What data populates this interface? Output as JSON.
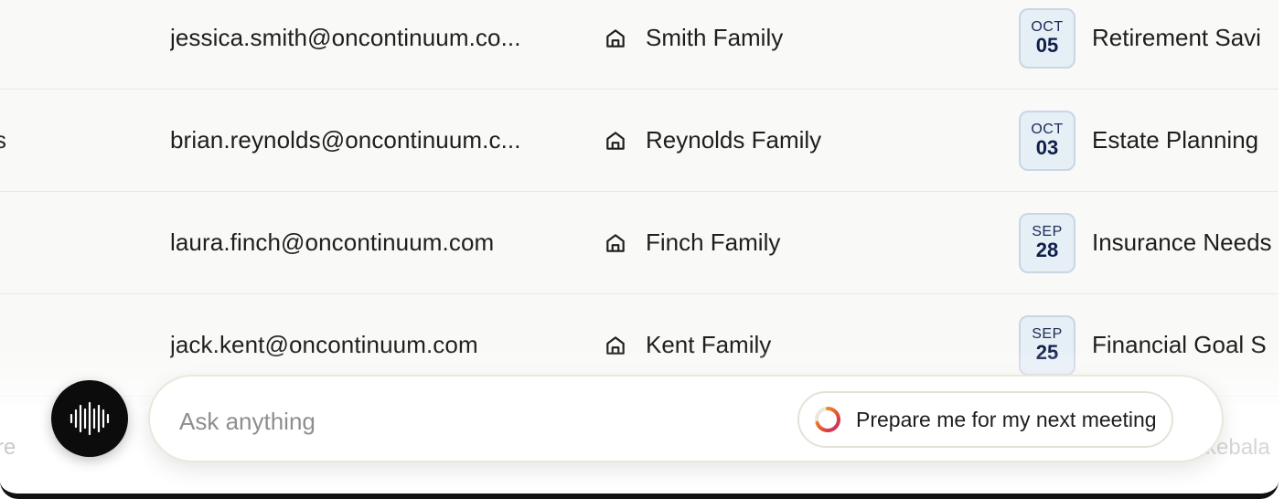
{
  "rows": [
    {
      "left_fragment": "",
      "email": "jessica.smith@oncontinuum.co...",
      "household": "Smith Family",
      "date_month": "OCT",
      "date_day": "05",
      "meeting": "Retirement Savi"
    },
    {
      "left_fragment": "s",
      "email": "brian.reynolds@oncontinuum.c...",
      "household": "Reynolds Family",
      "date_month": "OCT",
      "date_day": "03",
      "meeting": "Estate Planning"
    },
    {
      "left_fragment": "",
      "email": "laura.finch@oncontinuum.com",
      "household": "Finch Family",
      "date_month": "SEP",
      "date_day": "28",
      "meeting": "Insurance Needs"
    },
    {
      "left_fragment": "",
      "email": "jack.kent@oncontinuum.com",
      "household": "Kent Family",
      "date_month": "SEP",
      "date_day": "25",
      "meeting": "Financial Goal S"
    }
  ],
  "partial_row": {
    "left_fragment": "re",
    "right_fragment": "kebala"
  },
  "assistant": {
    "placeholder": "Ask anything",
    "suggestion": "Prepare me for my next meeting",
    "voice_icon": "waveform-icon",
    "suggestion_icon": "loading-ring-icon",
    "household_icon": "home-icon"
  },
  "colors": {
    "badge_bg": "#e6eef6",
    "badge_text": "#0f1f4a",
    "voice_button": "#0c0c0c",
    "ring_gradient": [
      "#f0b429",
      "#e8542f",
      "#c0266b"
    ]
  }
}
